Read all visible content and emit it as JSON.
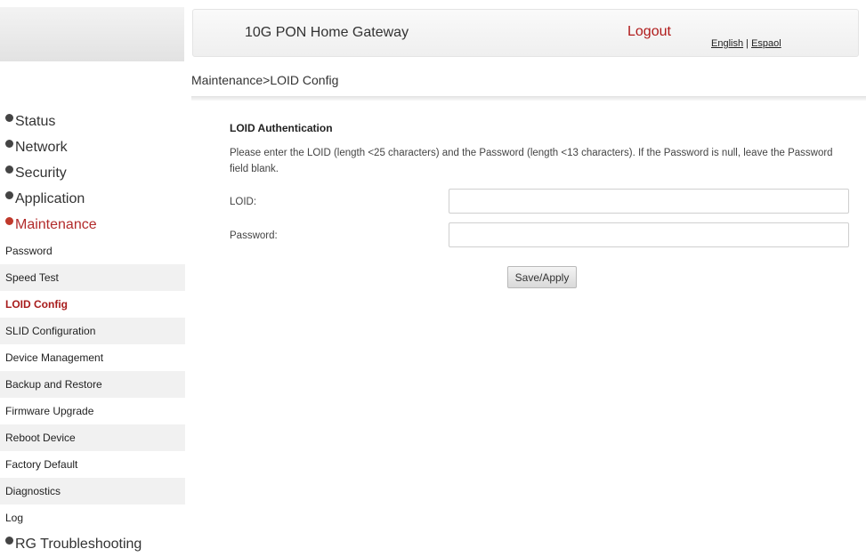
{
  "header": {
    "title": "10G PON Home Gateway",
    "logout_label": "Logout",
    "lang_english": "English",
    "lang_separator": " | ",
    "lang_spanish": "Espaol"
  },
  "breadcrumb": "Maintenance>LOID Config",
  "sidebar": {
    "top_items": [
      {
        "label": "Status"
      },
      {
        "label": "Network"
      },
      {
        "label": "Security"
      },
      {
        "label": "Application"
      },
      {
        "label": "Maintenance",
        "active": true
      }
    ],
    "sub_items": [
      {
        "label": "Password"
      },
      {
        "label": "Speed Test"
      },
      {
        "label": "LOID Config",
        "active": true
      },
      {
        "label": "SLID Configuration"
      },
      {
        "label": "Device Management"
      },
      {
        "label": "Backup and Restore"
      },
      {
        "label": "Firmware Upgrade"
      },
      {
        "label": "Reboot Device"
      },
      {
        "label": "Factory Default"
      },
      {
        "label": "Diagnostics"
      },
      {
        "label": "Log"
      }
    ],
    "bottom_item": {
      "label": "RG Troubleshooting"
    }
  },
  "content": {
    "section_title": "LOID Authentication",
    "description": "Please enter the LOID (length <25 characters) and the Password (length <13 characters). If the Password is null, leave the Password field blank.",
    "loid_label": "LOID:",
    "loid_value": "",
    "password_label": "Password:",
    "password_value": "",
    "apply_label": "Save/Apply"
  },
  "colors": {
    "active_red": "#b22b2b",
    "bullet_dark": "#444444",
    "bullet_red": "#c0392b"
  },
  "icons": {
    "nav_bullet": "plus-bullet-icon",
    "nav_bullet_active": "minus-bullet-icon"
  }
}
